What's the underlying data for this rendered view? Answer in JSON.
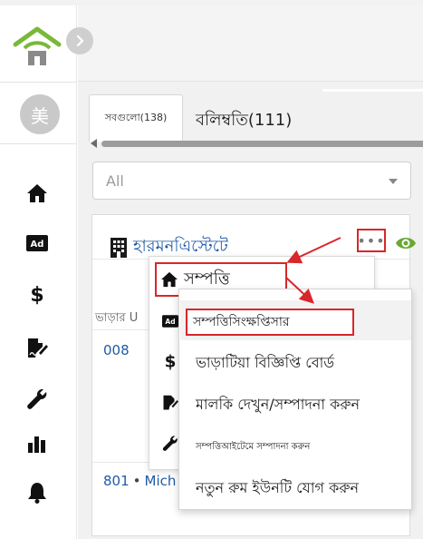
{
  "sidebar": {
    "avatar_text": "美",
    "nav_icons": [
      "home-icon",
      "ad-icon",
      "dollar-icon",
      "signature-icon",
      "wrench-icon",
      "bar-chart-icon",
      "bell-icon"
    ]
  },
  "tabs": {
    "all_label": "সবগুলো(138)",
    "other_label": "বলিম্বতি(111)"
  },
  "filter": {
    "selected": "All"
  },
  "card": {
    "title": "হারমনএিস্টেটে",
    "more_label": "•••",
    "tenant_header": "ভাড়ার U",
    "unit1": "008",
    "unit2_number": "801",
    "unit2_sep": "•",
    "unit2_name": "Mich"
  },
  "menu1": {
    "title": "সম্পত্তি",
    "icons": [
      "ad-icon",
      "dollar-icon",
      "signature-icon",
      "wrench-icon"
    ]
  },
  "menu2": {
    "items": [
      "সম্পত্তিসিংক্ষপ্তিসার",
      "ভাড়াটিয়া বিজ্ঞিপ্তি বোর্ড",
      "মালকি দেখুন/সম্পাদনা করুন",
      "সম্পত্তিআইটেমে সম্পাদনা করুন",
      "নতুন রুম ইউনটি যোগ করুন"
    ]
  },
  "colors": {
    "accent_red": "#d9262a",
    "link_blue": "#1f5aa6",
    "logo_green": "#7ab839",
    "eye_green": "#69a832"
  }
}
